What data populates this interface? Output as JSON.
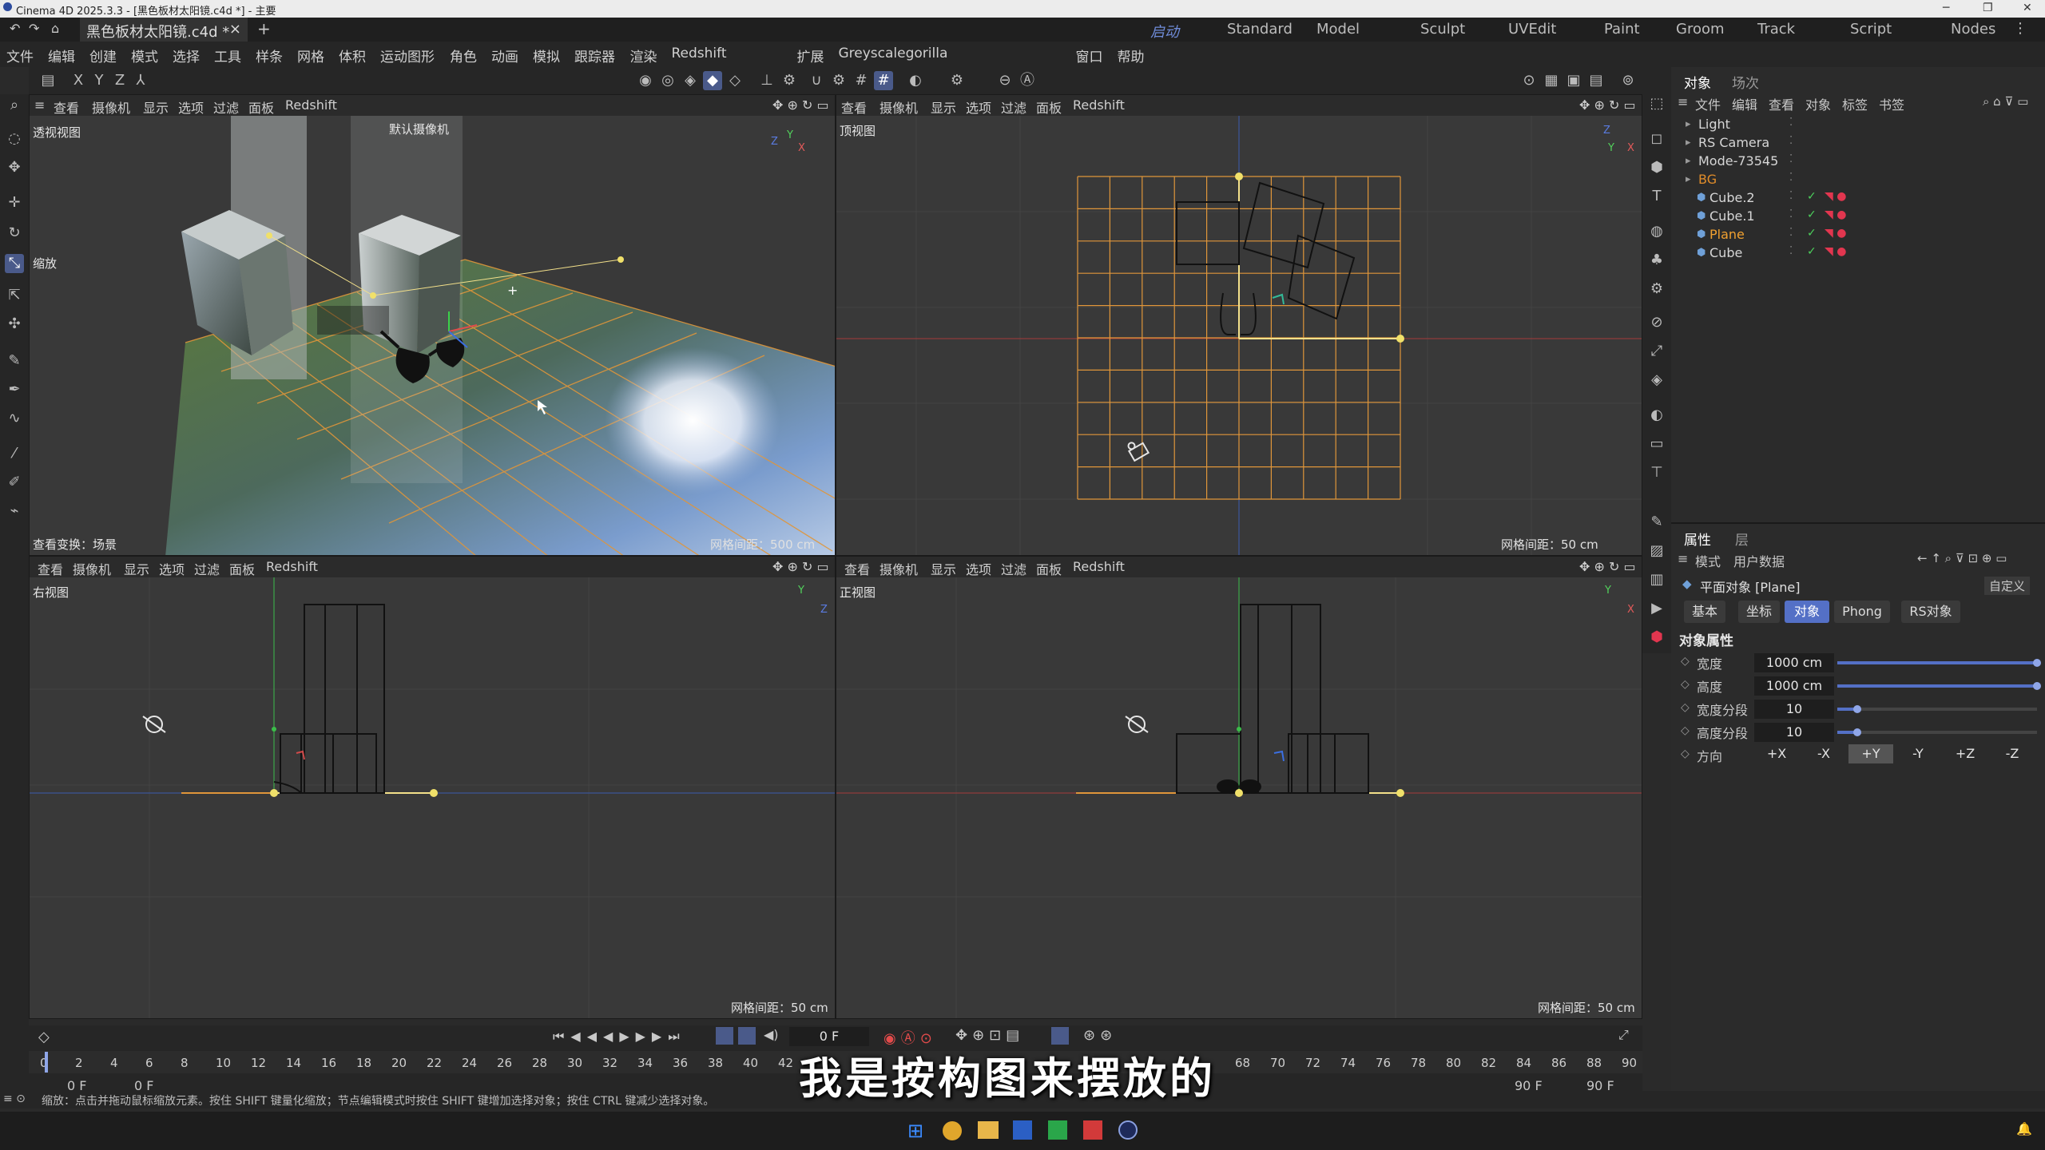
{
  "title_bar": {
    "text": "Cinema 4D 2025.3.3 - [黑色板材太阳镜.c4d *] - 主要"
  },
  "doc_tab": {
    "label": "黑色板材太阳镜.c4d *",
    "close": "×",
    "add": "+"
  },
  "layouts": [
    "启动",
    "Standard",
    "Model",
    "Sculpt",
    "UVEdit",
    "Paint",
    "Groom",
    "Track",
    "Script",
    "Nodes"
  ],
  "menu": [
    "文件",
    "编辑",
    "创建",
    "模式",
    "选择",
    "工具",
    "样条",
    "网格",
    "体积",
    "运动图形",
    "角色",
    "动画",
    "模拟",
    "跟踪器",
    "渲染",
    "Redshift",
    "扩展",
    "Greyscalegorilla",
    "窗口",
    "帮助"
  ],
  "axis_lock": [
    "X",
    "Y",
    "Z"
  ],
  "viewport_menu": [
    "查看",
    "摄像机",
    "显示",
    "选项",
    "过滤",
    "面板",
    "Redshift"
  ],
  "viewports": {
    "persp": {
      "name": "透视视图",
      "camera": "默认摄像机",
      "zoom_label": "缩放",
      "transform": "查看变换：场景",
      "grid": "网格间距：500 cm"
    },
    "top": {
      "name": "顶视图",
      "grid": "网格间距：50 cm"
    },
    "right": {
      "name": "右视图",
      "grid": "网格间距：50 cm"
    },
    "front": {
      "name": "正视图",
      "grid": "网格间距：50 cm"
    }
  },
  "object_manager": {
    "tabs": [
      "对象",
      "场次"
    ],
    "menu": [
      "文件",
      "编辑",
      "查看",
      "对象",
      "标签",
      "书签"
    ],
    "objects": [
      {
        "name": "Light",
        "indent": 0,
        "color": "#d6d6d6"
      },
      {
        "name": "RS Camera",
        "indent": 0,
        "color": "#d6d6d6"
      },
      {
        "name": "Mode-73545",
        "indent": 0,
        "color": "#d6d6d6"
      },
      {
        "name": "BG",
        "indent": 0,
        "color": "#e08c2a"
      },
      {
        "name": "Cube.2",
        "indent": 1,
        "color": "#d6d6d6"
      },
      {
        "name": "Cube.1",
        "indent": 1,
        "color": "#d6d6d6"
      },
      {
        "name": "Plane",
        "indent": 1,
        "color": "#f0a030"
      },
      {
        "name": "Cube",
        "indent": 1,
        "color": "#d6d6d6"
      }
    ]
  },
  "attributes": {
    "tabs": [
      "属性",
      "层"
    ],
    "menu": [
      "模式",
      "用户数据"
    ],
    "object_title": "平面对象 [Plane]",
    "preset": "自定义",
    "subtabs": [
      "基本",
      "坐标",
      "对象",
      "Phong",
      "RS对象"
    ],
    "section": "对象属性",
    "props": [
      {
        "label": "宽度",
        "value": "1000 cm",
        "level": 1.0
      },
      {
        "label": "高度",
        "value": "1000 cm",
        "level": 1.0
      },
      {
        "label": "宽度分段",
        "value": "10",
        "level": 0.1
      },
      {
        "label": "高度分段",
        "value": "10",
        "level": 0.1
      }
    ],
    "direction_label": "方向",
    "directions": [
      "+X",
      "-X",
      "+Y",
      "-Y",
      "+Z",
      "-Z"
    ],
    "direction_selected": "+Y"
  },
  "timeline": {
    "frame": "0 F",
    "ticks": [
      "0",
      "2",
      "4",
      "6",
      "8",
      "10",
      "12",
      "14",
      "16",
      "18",
      "20",
      "22",
      "24",
      "26",
      "28",
      "30",
      "32",
      "34",
      "36",
      "38",
      "40",
      "42",
      "68",
      "70",
      "72",
      "74",
      "76",
      "78",
      "80",
      "82",
      "84",
      "86",
      "88",
      "90"
    ],
    "start": "0 F",
    "start2": "0 F",
    "end": "90 F",
    "end2": "90 F"
  },
  "status": "缩放：点击并拖动鼠标缩放元素。按住 SHIFT 键量化缩放；节点编辑模式时按住 SHIFT 键增加选择对象；按住 CTRL 键减少选择对象。",
  "subtitle": "我是按构图来摆放的",
  "colors": {
    "accent": "#5470c6",
    "grid_orange": "#e0963a",
    "bg": "#2a2a2a"
  }
}
